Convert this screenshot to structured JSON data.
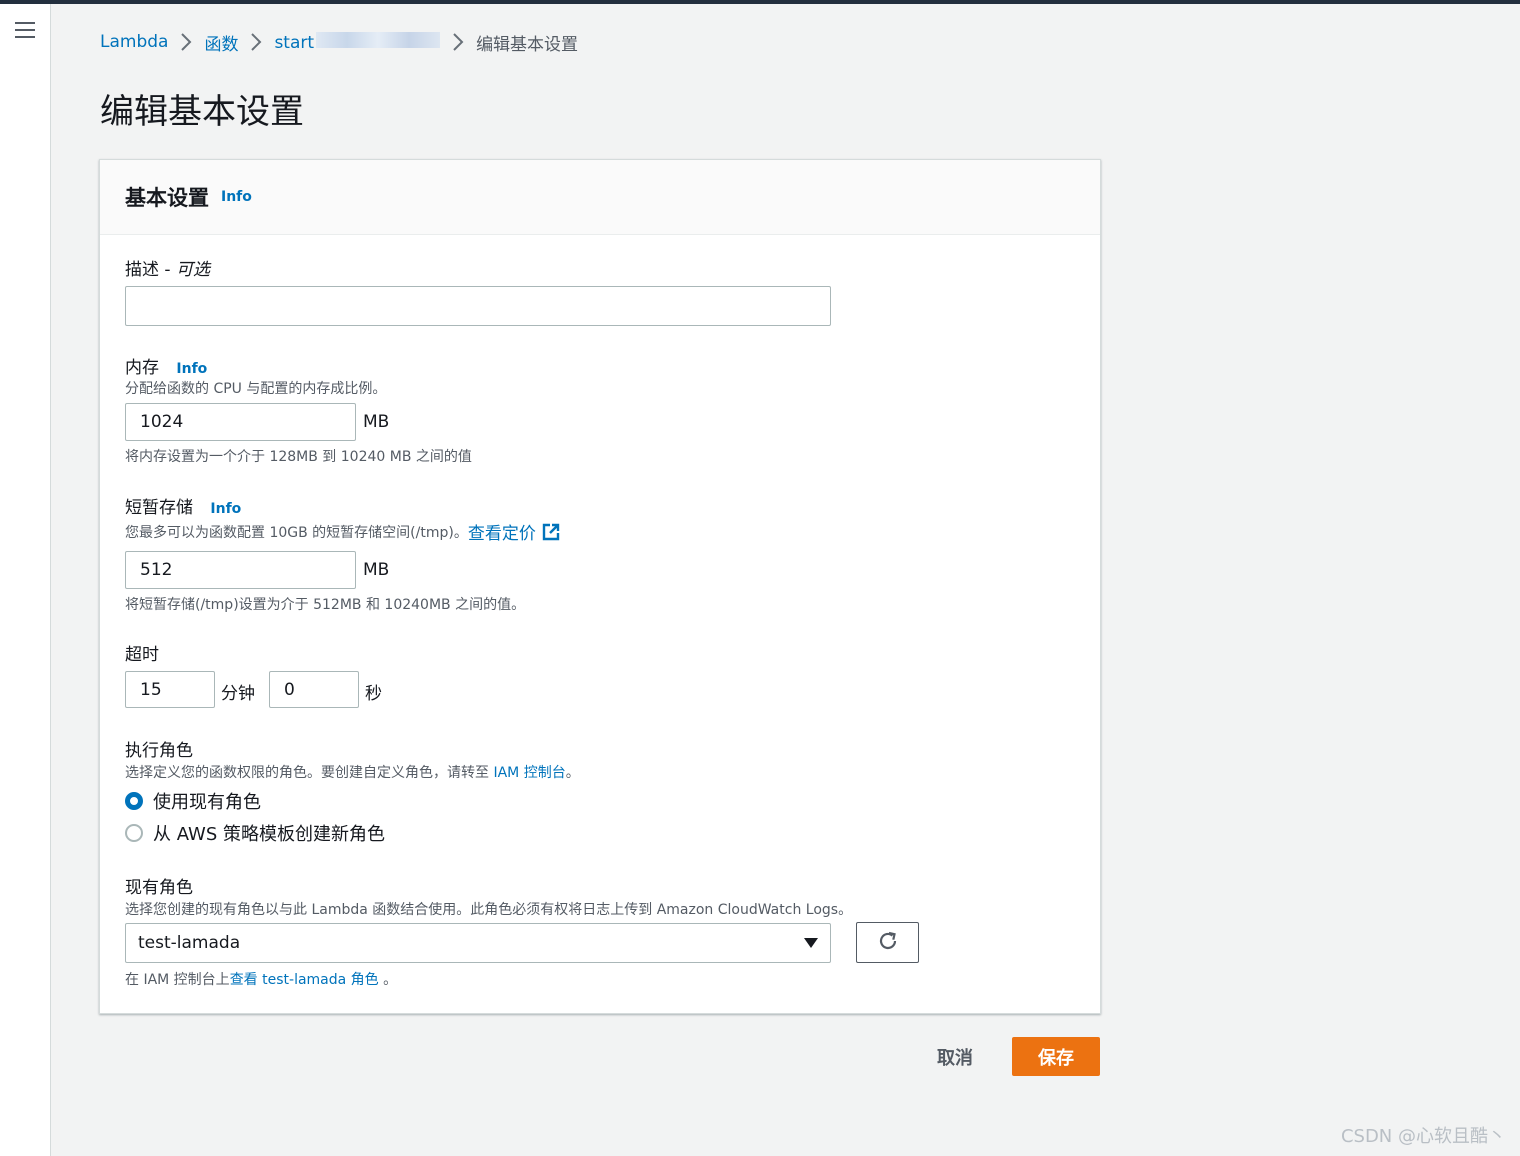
{
  "nav": {
    "menu_icon": "hamburger-menu-icon"
  },
  "breadcrumb": {
    "items": [
      "Lambda",
      "函数",
      "start"
    ],
    "current": "编辑基本设置",
    "separator_icon": "chevron-right-icon"
  },
  "page": {
    "title": "编辑基本设置"
  },
  "panel": {
    "title": "基本设置",
    "info": "Info"
  },
  "description_field": {
    "label": "描述 - ",
    "label_optional": "可选",
    "value": "",
    "placeholder": ""
  },
  "memory": {
    "label": "内存",
    "info": "Info",
    "description": "分配给函数的 CPU 与配置的内存成比例。",
    "value": "1024",
    "unit": "MB",
    "constraint": "将内存设置为一个介于 128MB 到 10240 MB 之间的值"
  },
  "ephemeral_storage": {
    "label": "短暂存储",
    "info": "Info",
    "description": "您最多可以为函数配置 10GB 的短暂存储空间(/tmp)。",
    "pricing_link": "查看定价",
    "link_icon": "external-link-icon",
    "value": "512",
    "unit": "MB",
    "constraint": "将短暂存储(/tmp)设置为介于 512MB 和 10240MB 之间的值。"
  },
  "timeout": {
    "label": "超时",
    "minutes_value": "15",
    "minutes_unit": "分钟",
    "seconds_value": "0",
    "seconds_unit": "秒"
  },
  "execution_role": {
    "label": "执行角色",
    "description": "选择定义您的函数权限的角色。要创建自定义角色，请转至 ",
    "iam_link": "IAM 控制台",
    "description_end": "。",
    "options": [
      {
        "label": "使用现有角色",
        "selected": true
      },
      {
        "label": "从 AWS 策略模板创建新角色",
        "selected": false
      }
    ]
  },
  "existing_role": {
    "label": "现有角色",
    "description": "选择您创建的现有角色以与此 Lambda 函数结合使用。此角色必须有权将日志上传到 Amazon CloudWatch Logs。",
    "selected": "test-lamada",
    "refresh_icon": "refresh-icon",
    "footer_prefix": "在 IAM 控制台上",
    "footer_link": "查看 test-lamada 角色",
    "footer_suffix": " 。"
  },
  "actions": {
    "cancel": "取消",
    "save": "保存"
  },
  "watermark": "CSDN @心软且酷丶",
  "colors": {
    "accent": "#ec7211",
    "link": "#0073bb",
    "background": "#f2f3f3"
  }
}
